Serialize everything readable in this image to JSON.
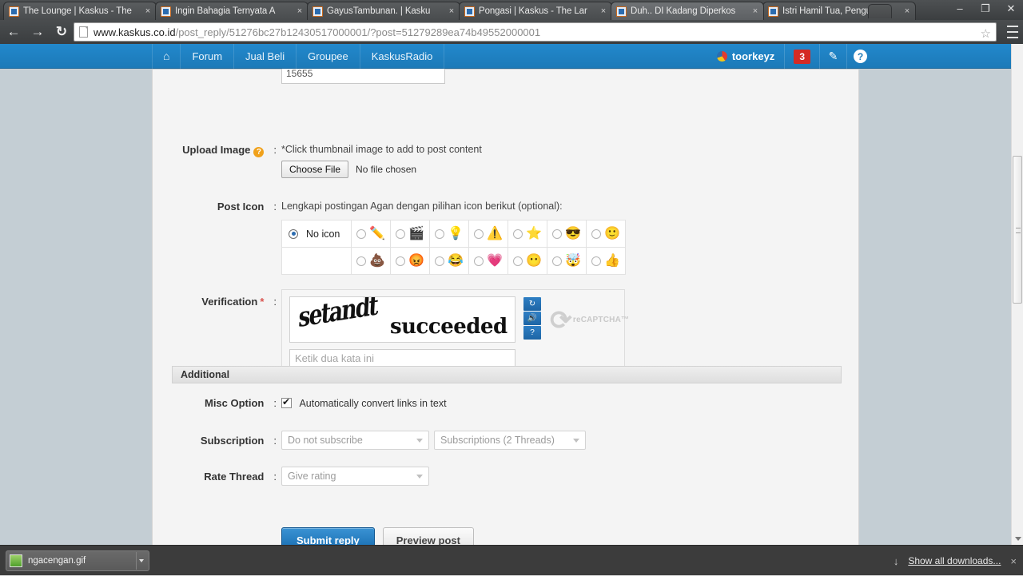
{
  "browser": {
    "tabs": [
      {
        "title": "The Lounge | Kaskus - The ",
        "active": false
      },
      {
        "title": "Ingin Bahagia Ternyata A",
        "active": false
      },
      {
        "title": "GayusTambunan. | Kasku",
        "active": false
      },
      {
        "title": "Pongasi | Kaskus - The Lar",
        "active": false
      },
      {
        "title": "Duh.. DI Kadang Diperkos",
        "active": true
      },
      {
        "title": "Istri Hamil Tua, Pengusah",
        "active": false
      }
    ],
    "tab_close_label": "×",
    "new_tab_label": "",
    "window_controls": {
      "minimize": "–",
      "maximize": "❐",
      "close": "✕"
    },
    "nav": {
      "back": "←",
      "forward": "→",
      "reload": "↻"
    },
    "url": {
      "domain": "www.kaskus.co.id",
      "path": "/post_reply/51276bc27b12430517000001/?post=51279289ea74b49552000001"
    },
    "bookmark_star": "☆"
  },
  "site_nav": {
    "home_icon": "⌂",
    "items": [
      {
        "label": "Forum"
      },
      {
        "label": "Jual Beli"
      },
      {
        "label": "Groupee"
      },
      {
        "label": "KaskusRadio"
      }
    ],
    "username": "toorkeyz",
    "notification_count": "3",
    "compose_icon": "✎",
    "help_icon": "?"
  },
  "form": {
    "top_field_value": "15655",
    "upload_image": {
      "label": "Upload Image",
      "help_icon": "?",
      "colon": ":",
      "hint": "*Click thumbnail image to add to post content",
      "choose_file_label": "Choose File",
      "no_file_text": "No file chosen"
    },
    "post_icon": {
      "label": "Post Icon",
      "colon": ":",
      "hint": "Lengkapi postingan Agan dengan pilihan icon berikut (optional):",
      "no_icon_label": "No icon",
      "row1": [
        "✏️",
        "🎬",
        "💡",
        "⚠️",
        "⭐",
        "😎",
        "🙂"
      ],
      "row1_names": [
        "pencil-icon",
        "clapperboard-icon",
        "lightbulb-icon",
        "warning-icon",
        "star-icon",
        "cool-face-icon",
        "smile-face-icon"
      ],
      "row2": [
        "💩",
        "😡",
        "😂",
        "💗",
        "😶",
        "🤯",
        "👍"
      ],
      "row2_names": [
        "poop-icon",
        "angry-face-icon",
        "laughing-face-icon",
        "heart-icon",
        "blue-face-icon",
        "explode-face-icon",
        "thumbs-up-icon"
      ]
    },
    "verification": {
      "label": "Verification",
      "required_mark": "*",
      "colon": ":",
      "captcha_word_1": "setandt",
      "captcha_word_2": "succeeded",
      "refresh_icon": "↻",
      "audio_icon": "🔊",
      "help_icon": "?",
      "recaptcha_glyph": "⟳",
      "recaptcha_label": "reCAPTCHA™",
      "input_placeholder": "Ketik dua kata ini",
      "input_value": ""
    }
  },
  "additional": {
    "section_title": "Additional",
    "misc_option": {
      "label": "Misc Option",
      "colon": ":",
      "checkbox_checked": true,
      "checkbox_label": "Automatically convert links in text"
    },
    "subscription": {
      "label": "Subscription",
      "colon": ":",
      "select1_value": "Do not subscribe",
      "select2_value": "Subscriptions (2 Threads)"
    },
    "rate_thread": {
      "label": "Rate Thread",
      "colon": ":",
      "select_value": "Give rating"
    },
    "submit_label": "Submit reply",
    "preview_label": "Preview post"
  },
  "download_shelf": {
    "file_name": "ngacengan.gif",
    "show_all_label": "Show all downloads...",
    "download_arrow_icon": "↓",
    "close_label": "×"
  },
  "colors": {
    "brand_blue": "#1c7ab8",
    "page_bg": "#c4ced4",
    "panel_bg": "#f4f4f4",
    "badge_red": "#d42b25",
    "accent_orange": "#f0a11b"
  }
}
